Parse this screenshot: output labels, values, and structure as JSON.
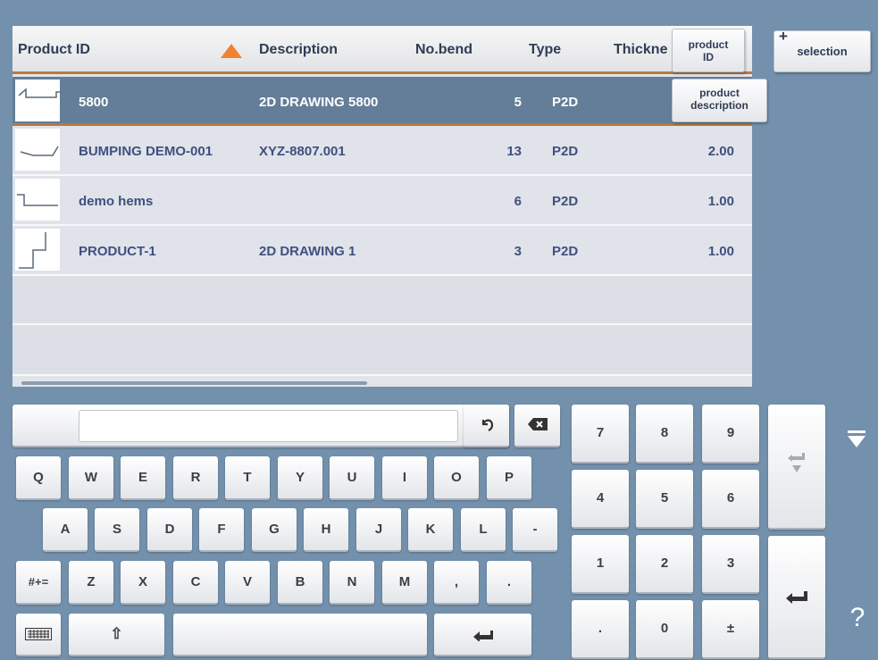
{
  "table": {
    "columns": {
      "product_id": "Product ID",
      "description": "Description",
      "no_bend": "No.bend",
      "type": "Type",
      "thickness": "Thickne"
    },
    "rows": [
      {
        "product_id": "5800",
        "description": "2D DRAWING 5800",
        "no_bend": "5",
        "type": "P2D",
        "thickness": ""
      },
      {
        "product_id": "BUMPING DEMO-001",
        "description": "XYZ-8807.001",
        "no_bend": "13",
        "type": "P2D",
        "thickness": "2.00"
      },
      {
        "product_id": "demo hems",
        "description": "",
        "no_bend": "6",
        "type": "P2D",
        "thickness": "1.00"
      },
      {
        "product_id": "PRODUCT-1",
        "description": "2D DRAWING 1",
        "no_bend": "3",
        "type": "P2D",
        "thickness": "1.00"
      }
    ],
    "selected_row": 0
  },
  "side_buttons": {
    "product_id": "product ID",
    "selection": "selection",
    "selection_prefix": "+",
    "product_description": "product description"
  },
  "keyboard": {
    "input_value": "",
    "row1": [
      "Q",
      "W",
      "E",
      "R",
      "T",
      "Y",
      "U",
      "I",
      "O",
      "P"
    ],
    "row2": [
      "A",
      "S",
      "D",
      "F",
      "G",
      "H",
      "J",
      "K",
      "L",
      "-"
    ],
    "row3": [
      "Z",
      "X",
      "C",
      "V",
      "B",
      "N",
      "M",
      ",",
      "."
    ],
    "symbols_key": "#+=",
    "shift_key": "⇧"
  },
  "numpad": {
    "keys": [
      "7",
      "8",
      "9",
      "4",
      "5",
      "6",
      "1",
      "2",
      "3",
      ".",
      "0",
      "±"
    ]
  },
  "help_label": "?",
  "colors": {
    "background": "#7391ac",
    "selected_row": "#647d98",
    "accent_orange": "#f08330",
    "text_blue": "#3f5080"
  }
}
